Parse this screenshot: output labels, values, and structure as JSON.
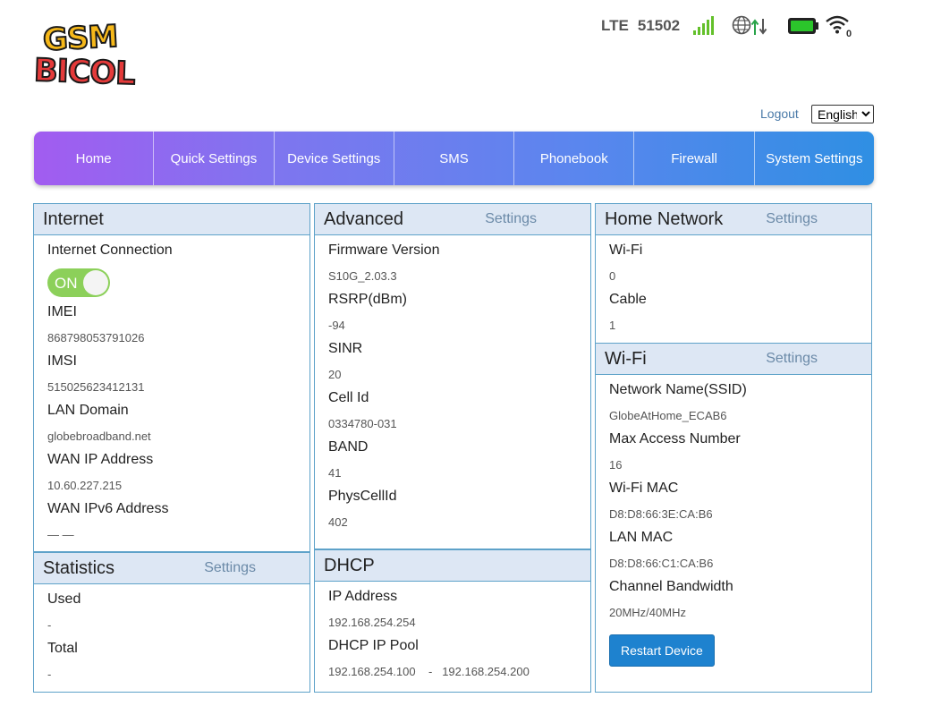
{
  "logo": {
    "line1": "GSM",
    "line2": "BICOL"
  },
  "status": {
    "network_type": "LTE",
    "operator": "51502",
    "signal_icon": "signal-bars-icon",
    "connection_icon": "globe-data-icon",
    "battery_icon": "battery-icon",
    "wifi_icon": "wifi-icon",
    "wifi_clients": "0",
    "colors": {
      "signal": "#63c02a",
      "battery": "#2bc52b"
    }
  },
  "header": {
    "logout": "Logout",
    "language": "English"
  },
  "nav": {
    "items": [
      "Home",
      "Quick Settings",
      "Device Settings",
      "SMS",
      "Phonebook",
      "Firewall",
      "System Settings"
    ]
  },
  "internet": {
    "title": "Internet",
    "connection_label": "Internet Connection",
    "toggle": "ON",
    "imei_label": "IMEI",
    "imei": "868798053791026",
    "imsi_label": "IMSI",
    "imsi": "515025623412131",
    "lan_domain_label": "LAN Domain",
    "lan_domain": "globebroadband.net",
    "wan_ip_label": "WAN IP Address",
    "wan_ip": "10.60.227.215",
    "wan_ipv6_label": "WAN IPv6 Address",
    "wan_ipv6": "— —"
  },
  "statistics": {
    "title": "Statistics",
    "settings": "Settings",
    "used_label": "Used",
    "used": "-",
    "total_label": "Total",
    "total": "-"
  },
  "advanced": {
    "title": "Advanced",
    "settings": "Settings",
    "firmware_label": "Firmware Version",
    "firmware": "S10G_2.03.3",
    "rsrp_label": "RSRP(dBm)",
    "rsrp": "-94",
    "sinr_label": "SINR",
    "sinr": "20",
    "cell_id_label": "Cell Id",
    "cell_id": "0334780-031",
    "band_label": "BAND",
    "band": "41",
    "physcell_label": "PhysCellId",
    "physcell": "402"
  },
  "dhcp": {
    "title": "DHCP",
    "ip_label": "IP Address",
    "ip": "192.168.254.254",
    "pool_label": "DHCP IP Pool",
    "pool": "192.168.254.100    -   192.168.254.200"
  },
  "home_network": {
    "title": "Home Network",
    "settings": "Settings",
    "wifi_label": "Wi-Fi",
    "wifi": "0",
    "cable_label": "Cable",
    "cable": "1"
  },
  "wifi": {
    "title": "Wi-Fi",
    "settings": "Settings",
    "ssid_label": "Network Name(SSID)",
    "ssid": "GlobeAtHome_ECAB6",
    "max_access_label": "Max Access Number",
    "max_access": "16",
    "wifi_mac_label": "Wi-Fi MAC",
    "wifi_mac": "D8:D8:66:3E:CA:B6",
    "lan_mac_label": "LAN MAC",
    "lan_mac": "D8:D8:66:C1:CA:B6",
    "bandwidth_label": "Channel Bandwidth",
    "bandwidth": "20MHz/40MHz",
    "restart": "Restart Device"
  }
}
